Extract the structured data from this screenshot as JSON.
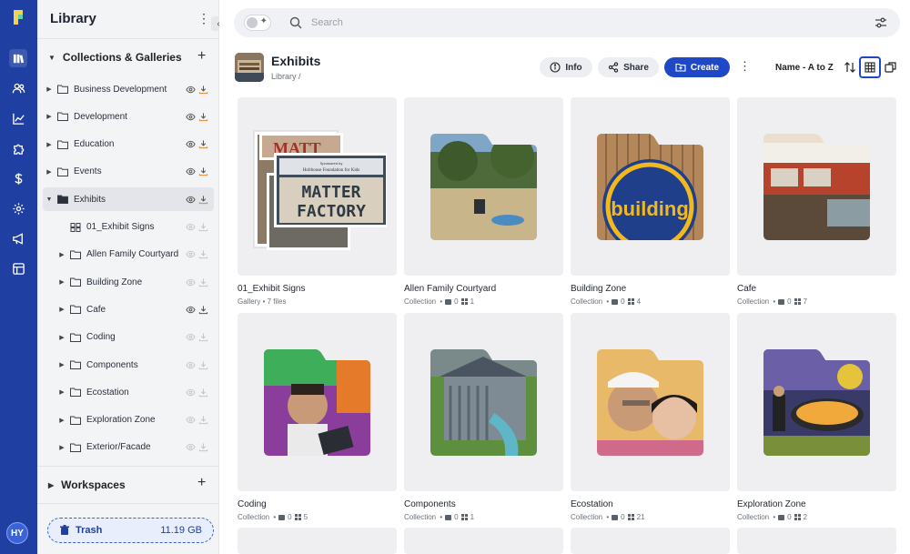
{
  "rail": {
    "icons": [
      "library-icon",
      "users-icon",
      "chart-icon",
      "puzzle-icon",
      "dollar-icon",
      "gear-icon",
      "megaphone-icon",
      "layout-icon"
    ],
    "avatar": "HY",
    "brand_color": "#1f3fa3"
  },
  "sidebar": {
    "title": "Library",
    "collections_label": "Collections & Galleries",
    "items": [
      {
        "label": "Business Development"
      },
      {
        "label": "Development"
      },
      {
        "label": "Education"
      },
      {
        "label": "Events"
      },
      {
        "label": "Exhibits",
        "selected": true
      }
    ],
    "children": [
      {
        "label": "01_Exhibit Signs",
        "type": "gallery"
      },
      {
        "label": "Allen Family Courtyard"
      },
      {
        "label": "Building Zone"
      },
      {
        "label": "Cafe"
      },
      {
        "label": "Coding"
      },
      {
        "label": "Components"
      },
      {
        "label": "Ecostation"
      },
      {
        "label": "Exploration Zone"
      },
      {
        "label": "Exterior/Facade"
      }
    ],
    "workspaces_label": "Workspaces",
    "trash_label": "Trash",
    "trash_size": "11.19 GB"
  },
  "search": {
    "placeholder": "Search"
  },
  "header": {
    "title": "Exhibits",
    "breadcrumb": "Library /",
    "info_label": "Info",
    "share_label": "Share",
    "create_label": "Create",
    "sort_label": "Name - A to Z",
    "accent": "#1f48c7"
  },
  "cards": [
    {
      "name": "01_Exhibit Signs",
      "meta": "Gallery • 7 files"
    },
    {
      "name": "Allen Family Courtyard",
      "type": "Collection",
      "folders": "0",
      "items": "1"
    },
    {
      "name": "Building Zone",
      "type": "Collection",
      "folders": "0",
      "items": "4"
    },
    {
      "name": "Cafe",
      "type": "Collection",
      "folders": "0",
      "items": "7"
    },
    {
      "name": "Coding",
      "type": "Collection",
      "folders": "0",
      "items": "5"
    },
    {
      "name": "Components",
      "type": "Collection",
      "folders": "0",
      "items": "1"
    },
    {
      "name": "Ecostation",
      "type": "Collection",
      "folders": "0",
      "items": "21"
    },
    {
      "name": "Exploration Zone",
      "type": "Collection",
      "folders": "0",
      "items": "2"
    }
  ],
  "sign": {
    "sponsor": "Sponsored by",
    "foundation": "Holthouse Foundation for Kids",
    "line1": "MATTER",
    "line2": "FACTORY"
  },
  "building_sign": "building"
}
